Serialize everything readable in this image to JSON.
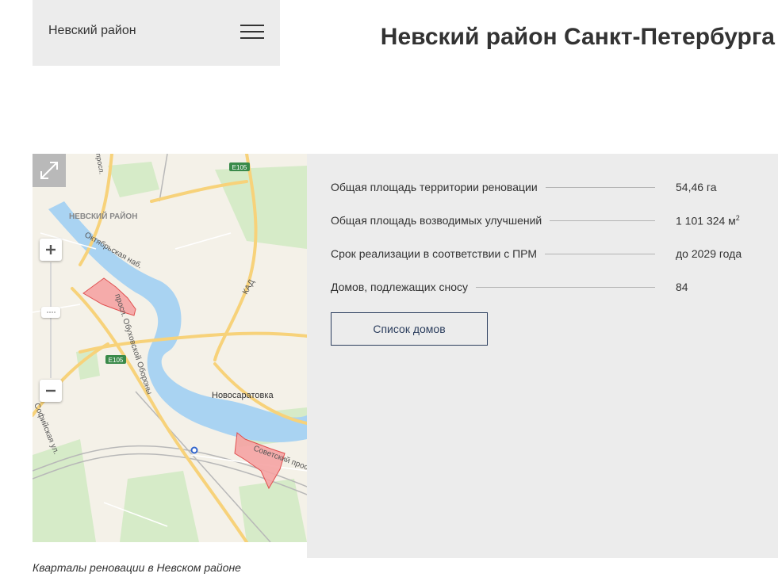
{
  "header": {
    "district_name": "Невский район",
    "page_title": "Невский район Санкт-Петербурга"
  },
  "map": {
    "controls": {
      "fullscreen_icon": "expand-arrows-icon",
      "zoom_in_icon": "plus-icon",
      "zoom_out_icon": "minus-icon"
    },
    "labels": {
      "district": "НЕВСКИЙ РАЙОН",
      "embankment": "Октябрьская наб.",
      "prospect_obukhov": "просп. Обуховской Обороны",
      "kad": "КАД",
      "e105_top": "E105",
      "e105_bottom": "E105",
      "novosaratovka": "Новосаратовка",
      "sofiyskaya": "Софийская ул.",
      "sovetsky": "Советский просп.",
      "prosp_top": "просп."
    },
    "colors": {
      "water": "#a9d3f2",
      "road_major": "#f7d27a",
      "renovation_area": "#f5a3a3",
      "renovation_border": "#e05050",
      "green": "#d6ebc8"
    }
  },
  "stats": {
    "rows": [
      {
        "label": "Общая площадь территории реновации",
        "value": "54,46 га",
        "sup": ""
      },
      {
        "label": "Общая площадь возводимых улучшений",
        "value": "1 101 324 м",
        "sup": "2"
      },
      {
        "label": "Срок реализации в соответствии с ПРМ",
        "value": "до 2029 года",
        "sup": ""
      },
      {
        "label": "Домов, подлежащих сносу",
        "value": "84",
        "sup": ""
      }
    ],
    "houses_button": "Список домов"
  },
  "caption": "Кварталы реновации в Невском районе"
}
